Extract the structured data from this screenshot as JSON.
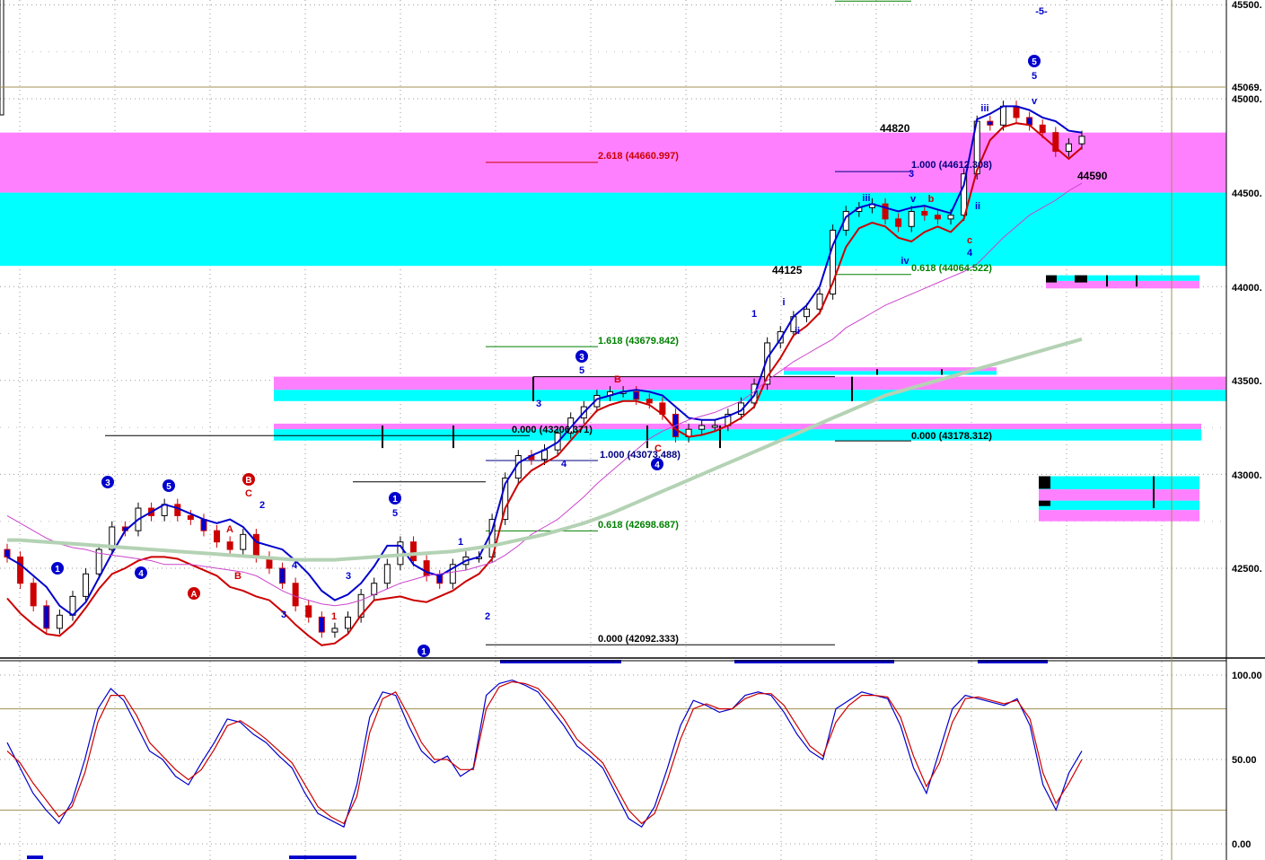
{
  "chart_data": [
    {
      "type": "candlestick",
      "title": "",
      "y_axis": {
        "range": [
          42100,
          45500
        ],
        "ticks": [
          "42500.",
          "43000.",
          "43500.",
          "44000.",
          "44500.",
          "45000.",
          "45500."
        ],
        "marker_label": "45069.",
        "marker_value": 45069,
        "grid": "dotted"
      },
      "series": [
        {
          "color": "#0000cc",
          "values": [
            42560,
            42520,
            42460,
            42400,
            42300,
            42250,
            42320,
            42450,
            42580,
            42700,
            42760,
            42800,
            42840,
            42820,
            42790,
            42760,
            42740,
            42760,
            42720,
            42640,
            42620,
            42600,
            42540,
            42470,
            42380,
            42330,
            42360,
            42420,
            42510,
            42620,
            42620,
            42520,
            42480,
            42460,
            42500,
            42540,
            42560,
            42700,
            42950,
            43060,
            43100,
            43130,
            43170,
            43250,
            43330,
            43400,
            43420,
            43440,
            43450,
            43440,
            43420,
            43360,
            43300,
            43290,
            43290,
            43310,
            43340,
            43420,
            43620,
            43720,
            43840,
            43900,
            44000,
            44220,
            44370,
            44420,
            44440,
            44420,
            44400,
            44420,
            44430,
            44410,
            44390,
            44540,
            44890,
            44920,
            44960,
            44960,
            44940,
            44900,
            44880,
            44830,
            44820
          ]
        },
        {
          "color": "#cc0000",
          "values": [
            42340,
            42260,
            42200,
            42150,
            42140,
            42200,
            42290,
            42390,
            42470,
            42500,
            42540,
            42560,
            42560,
            42550,
            42520,
            42490,
            42460,
            42400,
            42380,
            42350,
            42330,
            42270,
            42200,
            42140,
            42090,
            42100,
            42150,
            42250,
            42330,
            42340,
            42350,
            42330,
            42320,
            42350,
            42380,
            42430,
            42470,
            42550,
            42820,
            42950,
            43020,
            43060,
            43100,
            43180,
            43260,
            43340,
            43370,
            43390,
            43390,
            43370,
            43320,
            43240,
            43200,
            43210,
            43230,
            43260,
            43300,
            43360,
            43520,
            43620,
            43740,
            43790,
            43860,
            44020,
            44210,
            44310,
            44340,
            44320,
            44260,
            44240,
            44290,
            44320,
            44290,
            44360,
            44620,
            44780,
            44850,
            44870,
            44860,
            44800,
            44740,
            44680,
            44740
          ]
        },
        {
          "color": "#cc44cc",
          "values": [
            42780,
            42740,
            42700,
            42660,
            42630,
            42610,
            42600,
            42580,
            42570,
            42560,
            42550,
            42540,
            42520,
            42520,
            42520,
            42510,
            42500,
            42490,
            42480,
            42460,
            42420,
            42380,
            42350,
            42330,
            42310,
            42300,
            42310,
            42330,
            42360,
            42390,
            42420,
            42440,
            42460,
            42470,
            42480,
            42490,
            42510,
            42530,
            42570,
            42620,
            42680,
            42720,
            42760,
            42820,
            42880,
            42950,
            43010,
            43070,
            43130,
            43190,
            43230,
            43260,
            43290,
            43310,
            43330,
            43360,
            43390,
            43440,
            43500,
            43550,
            43600,
            43640,
            43680,
            43720,
            43780,
            43820,
            43860,
            43900,
            43930,
            43960,
            43990,
            44020,
            44050,
            44080,
            44120,
            44190,
            44260,
            44320,
            44380,
            44420,
            44460,
            44510,
            44550
          ]
        },
        {
          "color": "#b4d2b4",
          "values": [
            42650,
            42650,
            42645,
            42640,
            42635,
            42630,
            42625,
            42620,
            42615,
            42610,
            42605,
            42600,
            42595,
            42590,
            42585,
            42580,
            42575,
            42570,
            42565,
            42560,
            42555,
            42550,
            42545,
            42545,
            42545,
            42545,
            42550,
            42555,
            42560,
            42565,
            42570,
            42575,
            42580,
            42585,
            42590,
            42600,
            42610,
            42620,
            42635,
            42650,
            42665,
            42680,
            42700,
            42720,
            42740,
            42765,
            42790,
            42820,
            42850,
            42880,
            42910,
            42940,
            42970,
            43000,
            43030,
            43060,
            43090,
            43120,
            43150,
            43180,
            43210,
            43240,
            43270,
            43300,
            43330,
            43360,
            43390,
            43420,
            43440,
            43460,
            43480,
            43500,
            43520,
            43540,
            43560,
            43580,
            43600,
            43620,
            43640,
            43660,
            43680,
            43700,
            43720
          ]
        }
      ],
      "candles_close": [
        42560,
        42420,
        42300,
        42180,
        42250,
        42350,
        42470,
        42600,
        42720,
        42700,
        42820,
        42780,
        42840,
        42780,
        42760,
        42700,
        42640,
        42600,
        42680,
        42560,
        42500,
        42420,
        42300,
        42240,
        42160,
        42180,
        42240,
        42360,
        42420,
        42520,
        42640,
        42540,
        42460,
        42420,
        42520,
        42560,
        42560,
        42760,
        42980,
        43100,
        43080,
        43130,
        43220,
        43300,
        43360,
        43420,
        43440,
        43440,
        43400,
        43380,
        43320,
        43200,
        43240,
        43260,
        43260,
        43320,
        43380,
        43480,
        43700,
        43760,
        43840,
        43880,
        43960,
        44300,
        44400,
        44420,
        44440,
        44360,
        44320,
        44400,
        44380,
        44360,
        44380,
        44600,
        44880,
        44860,
        44960,
        44900,
        44860,
        44820,
        44720,
        44760,
        44800
      ],
      "zones": [
        {
          "color": "#ff80ff",
          "low": 44500,
          "high": 44820
        },
        {
          "color": "#00ffff",
          "low": 44110,
          "high": 44500
        },
        {
          "color": "#ff80ff",
          "low": 43450,
          "high": 43520
        },
        {
          "color": "#00ffff",
          "low": 43390,
          "high": 43450
        },
        {
          "color": "#ff80ff",
          "low": 43240,
          "high": 43270
        },
        {
          "color": "#00ffff",
          "low": 43180,
          "high": 43240
        }
      ],
      "fib_levels": [
        {
          "text": "2.618 (44660.997)",
          "color": "#cc0000",
          "value": 44660.997
        },
        {
          "text": "1.000 (44612.308)",
          "color": "#000080",
          "value": 44612.308
        },
        {
          "text": "0.618 (44064.522)",
          "color": "#008000",
          "value": 44064.522
        },
        {
          "text": "1.618 (43679.842)",
          "color": "#008000",
          "value": 43679.842
        },
        {
          "text": "0.000 (43206.371)",
          "color": "#000000",
          "value": 43206.371
        },
        {
          "text": "1.000 (43073.488)",
          "color": "#000080",
          "value": 43073.488
        },
        {
          "text": "0.000 (43178.312)",
          "color": "#000000",
          "value": 43178.312
        },
        {
          "text": "0.618 (42698.687)",
          "color": "#008000",
          "value": 42698.687
        },
        {
          "text": "0.000 (42092.333)",
          "color": "#000000",
          "value": 42092.333
        }
      ],
      "price_notes": [
        {
          "text": "44820",
          "value": 44820
        },
        {
          "text": "44590",
          "value": 44590
        },
        {
          "text": "44125",
          "value": 44125
        }
      ],
      "wave_labels": {
        "circled": [
          "1",
          "2",
          "3",
          "4",
          "5",
          "A",
          "B",
          "1",
          "3",
          "4",
          "5"
        ],
        "plain": [
          "1",
          "2",
          "3",
          "4",
          "5",
          "A",
          "B",
          "C",
          "a",
          "b",
          "c",
          "i",
          "ii",
          "iii",
          "iv",
          "v",
          "-5-"
        ]
      }
    },
    {
      "type": "line",
      "title": "",
      "y_axis": {
        "range": [
          0,
          100
        ],
        "ticks": [
          "100.00",
          "50.00",
          "0.00"
        ],
        "levels": [
          80,
          20
        ]
      },
      "series": [
        {
          "color": "#0000cc",
          "values": [
            60,
            45,
            30,
            20,
            12,
            25,
            50,
            80,
            92,
            85,
            70,
            55,
            50,
            40,
            35,
            48,
            60,
            74,
            72,
            65,
            60,
            52,
            45,
            30,
            18,
            14,
            10,
            35,
            75,
            90,
            88,
            70,
            55,
            48,
            52,
            40,
            45,
            88,
            95,
            97,
            94,
            90,
            80,
            70,
            58,
            52,
            45,
            30,
            15,
            10,
            22,
            45,
            70,
            85,
            82,
            78,
            80,
            88,
            90,
            88,
            78,
            65,
            55,
            50,
            80,
            85,
            90,
            88,
            86,
            70,
            45,
            30,
            55,
            80,
            88,
            86,
            84,
            82,
            86,
            70,
            35,
            20,
            42,
            55
          ]
        },
        {
          "color": "#cc0000",
          "values": [
            55,
            48,
            36,
            26,
            16,
            22,
            42,
            72,
            88,
            88,
            76,
            60,
            52,
            44,
            38,
            44,
            56,
            70,
            73,
            68,
            62,
            55,
            48,
            35,
            22,
            16,
            12,
            28,
            66,
            86,
            90,
            76,
            60,
            50,
            50,
            44,
            44,
            80,
            93,
            96,
            95,
            92,
            84,
            74,
            62,
            55,
            48,
            34,
            20,
            12,
            18,
            38,
            62,
            80,
            83,
            80,
            80,
            86,
            89,
            89,
            82,
            70,
            58,
            52,
            72,
            82,
            88,
            88,
            87,
            75,
            52,
            34,
            48,
            72,
            86,
            87,
            85,
            83,
            85,
            74,
            42,
            24,
            36,
            50
          ]
        }
      ]
    }
  ]
}
